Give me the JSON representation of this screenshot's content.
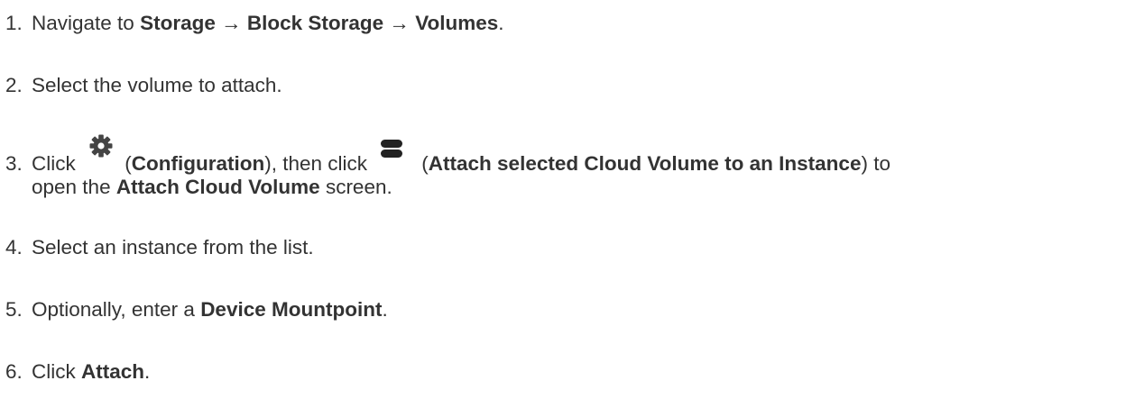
{
  "steps": [
    {
      "number": "1.",
      "prefix": "Navigate to ",
      "b1": "Storage",
      "arrow1": " → ",
      "b2": "Block Storage",
      "arrow2": " → ",
      "b3": "Volumes",
      "suffix": "."
    },
    {
      "number": "2.",
      "text": "Select the volume to attach."
    },
    {
      "number": "3.",
      "click1": "Click ",
      "open1": " (",
      "b_config": "Configuration",
      "mid": "), then click ",
      "open2": "(",
      "b_attach_selected": "Attach selected Cloud Volume to an Instance",
      "after": ") to",
      "line2_prefix": "open the ",
      "b_attach_screen": "Attach Cloud Volume",
      "line2_suffix": " screen.",
      "icon1": "gear-icon",
      "icon2": "database-icon"
    },
    {
      "number": "4.",
      "text": "Select an instance from the list."
    },
    {
      "number": "5.",
      "prefix": "Optionally, enter a ",
      "bold": "Device Mountpoint",
      "suffix": "."
    },
    {
      "number": "6.",
      "prefix": "Click ",
      "bold": "Attach",
      "suffix": "."
    }
  ],
  "colors": {
    "text": "#333333",
    "icon": "#444444",
    "background": "#ffffff"
  }
}
